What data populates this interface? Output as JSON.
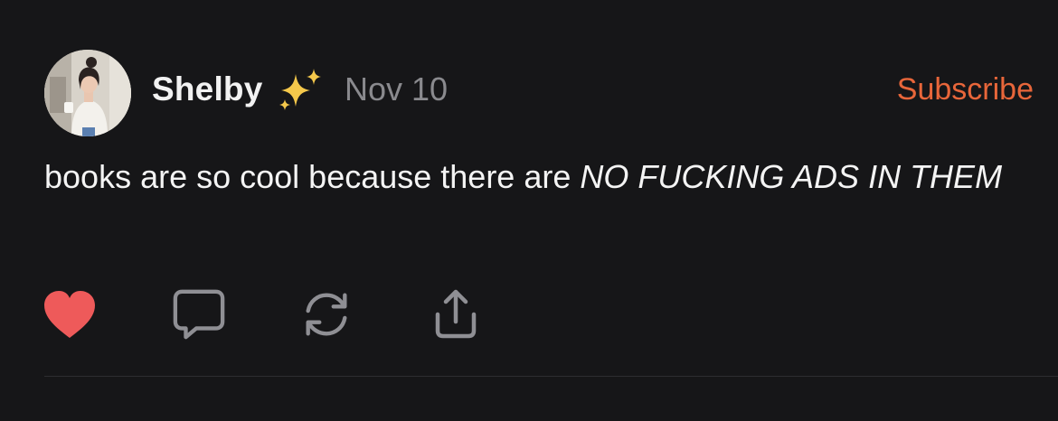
{
  "post": {
    "author": {
      "name": "Shelby",
      "badge_icon": "sparkles-icon",
      "avatar_icon": "avatar"
    },
    "date": "Nov 10",
    "subscribe_label": "Subscribe",
    "body": {
      "plain": "books are so cool because there are ",
      "italic": "NO FUCKING ADS IN THEM"
    },
    "actions": [
      {
        "icon": "heart-icon",
        "liked": true
      },
      {
        "icon": "comment-icon"
      },
      {
        "icon": "restack-icon"
      },
      {
        "icon": "share-icon"
      }
    ]
  },
  "colors": {
    "background": "#161618",
    "accent": "#e8663a",
    "heart": "#ee5a5a",
    "muted": "#8a8a8e",
    "icon": "#8f8f94"
  }
}
